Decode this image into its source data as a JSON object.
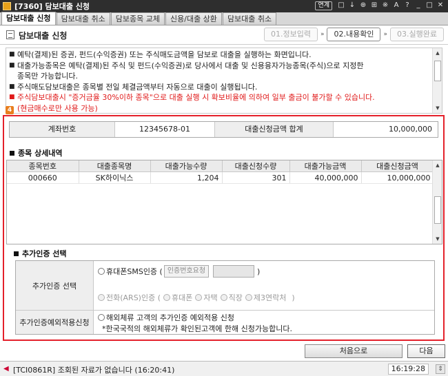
{
  "window": {
    "title": "[7360] 담보대출 신청",
    "link_label": "연계",
    "controls": [
      "□",
      "↓",
      "⊕",
      "⊞",
      "※",
      "A",
      "?",
      "_",
      "□",
      "✕"
    ]
  },
  "tabs": [
    {
      "label": "담보대출 신청",
      "active": true
    },
    {
      "label": "담보대출 취소",
      "active": false
    },
    {
      "label": "담보종목 교체",
      "active": false
    },
    {
      "label": "신용/대출 상환",
      "active": false
    },
    {
      "label": "담보대출 취소",
      "active": false
    }
  ],
  "header": {
    "title": "담보대출 신청",
    "steps": [
      {
        "num": "01.",
        "label": "정보입력",
        "active": false
      },
      {
        "num": "02.",
        "label": "내용확인",
        "active": true
      },
      {
        "num": "03.",
        "label": "실행완료",
        "active": false
      }
    ],
    "step_separator": "»"
  },
  "notice": {
    "lines": [
      {
        "text": "예탁(결제)된 증권, 펀드(수익증권) 또는 주식매도금액을 담보로 대출을 실행하는 화면입니다.",
        "bullet": true,
        "red": false
      },
      {
        "text": "대출가능종목은 예탁(결제)된 주식 및 펀드(수익증권)로 당사에서 대출 및 신용융자가능종목(주식)으로 지정한",
        "bullet": true,
        "red": false
      },
      {
        "text": "종목만 가능합니다.",
        "bullet": false,
        "red": false
      },
      {
        "text": "주식매도담보대출은 종목별 전일 체결금액부터 자동으로 대출이 실행됩니다.",
        "bullet": true,
        "red": false
      },
      {
        "text": "주식담보대출시 \"증거금율 30%이하 종목\"으로 대출 실행 시 확보비율에 의하여 일부 출금이 불가할 수 있습니다.",
        "bullet": true,
        "red": true
      },
      {
        "text": "(현금매수로만 사용 가능)",
        "bullet": false,
        "red": true
      }
    ],
    "badge": "4"
  },
  "summary": {
    "account_label": "계좌번호",
    "account_value": "12345678-01",
    "total_label": "대출신청금액 합계",
    "total_value": "10,000,000"
  },
  "detail": {
    "title": "종목 상세내역",
    "columns": [
      "종목번호",
      "대출종목명",
      "대출가능수량",
      "대출신청수량",
      "대출가능금액",
      "대출신청금액"
    ],
    "rows": [
      [
        "000660",
        "SK하이닉스",
        "1,204",
        "301",
        "40,000,000",
        "10,000,000"
      ]
    ]
  },
  "auth": {
    "title": "추가인증 선택",
    "row1_label": "추가인증 선택",
    "sms_option": "휴대폰SMS인증 (",
    "request_button": "인증번호요청",
    "close_paren": ")",
    "ars_option": "전화(ARS)인증 (",
    "ars_sub": [
      "휴대폰",
      "자택",
      "직장",
      "제3연락처"
    ],
    "ars_close": ")",
    "row2_label": "추가인증예외적용신청",
    "overseas_option": "해외체류 고객의 추가인증 예외적용 신청",
    "overseas_note": "*한국국적의 해외체류가 확인된고객에 한해 신청가능합니다."
  },
  "buttons": {
    "first": "처음으로",
    "next": "다음"
  },
  "status": {
    "message": "[TCI0861R] 조회된 자료가 없습니다 (16:20:41)",
    "clock": "16:19:28",
    "grip": "⇕"
  }
}
